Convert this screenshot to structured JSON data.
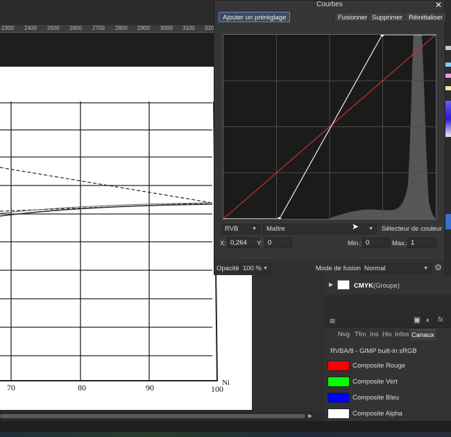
{
  "ruler": {
    "ticks": [
      "2300",
      "2400",
      "2500",
      "2600",
      "2700",
      "2800",
      "2900",
      "3000",
      "3100",
      "320"
    ]
  },
  "document": {
    "x_labels": [
      "70",
      "80",
      "90",
      "100"
    ],
    "corner_label": "Ni"
  },
  "dialog": {
    "title": "Courbes",
    "close_glyph": "✕",
    "buttons": {
      "add_preset": "Ajouter un préréglage",
      "merge": "Fusionner",
      "delete": "Supprimer",
      "reset": "Réinitialiser"
    },
    "color_space": "RVB",
    "channel": "Maître",
    "picker_label": "Sélecteur de couleur",
    "x_label": "X:",
    "x_value": "0,264",
    "y_label": "Y:",
    "y_value": "0",
    "min_label": "Min.:",
    "min_value": "0",
    "max_label": "Max.:",
    "max_value": "1",
    "opacity_label": "Opacité:",
    "opacity_value": "100 %",
    "blend_label": "Mode de fusion:",
    "blend_value": "Normal",
    "curve_points": [
      [
        0.264,
        0
      ],
      [
        0.748,
        1
      ]
    ]
  },
  "layers": {
    "group_name": "CMYK",
    "group_suffix": "(Groupe)"
  },
  "tabs": [
    {
      "label": "Nvg"
    },
    {
      "label": "Tfm"
    },
    {
      "label": "Ins"
    },
    {
      "label": "His"
    },
    {
      "label": "Infos"
    },
    {
      "label": "Canaux"
    }
  ],
  "channels_panel": {
    "profile": "RVBA/8 - GIMP built-in sRGB",
    "channels": [
      {
        "label": "Composite Rouge",
        "color": "#ff0000"
      },
      {
        "label": "Composite Vert",
        "color": "#00ff00"
      },
      {
        "label": "Composite Bleu",
        "color": "#0000ff"
      },
      {
        "label": "Composite Alpha",
        "color": "#ffffff"
      }
    ]
  },
  "icons": [
    "close-icon",
    "gear-icon",
    "play-icon",
    "layers-icon",
    "mask-icon",
    "adjust-icon",
    "fx-icon"
  ]
}
